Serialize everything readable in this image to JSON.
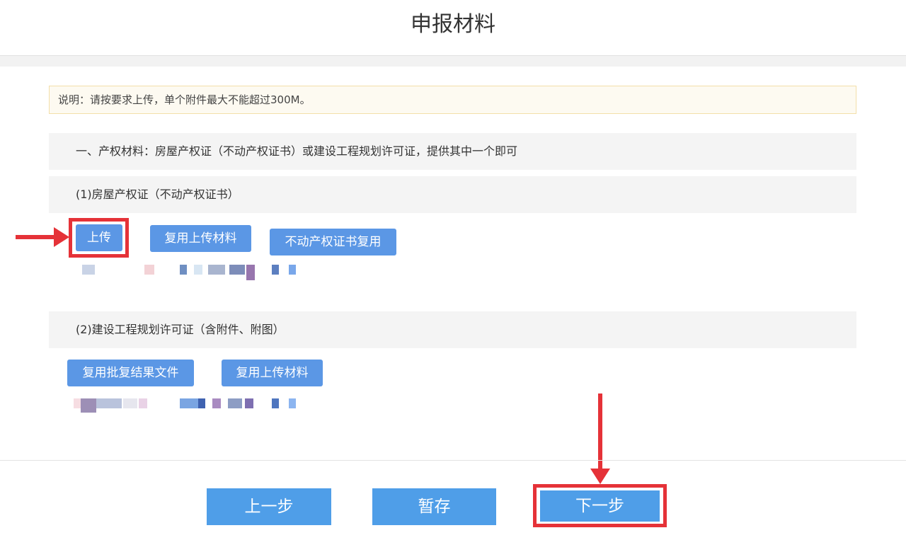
{
  "header": {
    "title": "申报材料"
  },
  "notice": {
    "text": "说明：请按要求上传，单个附件最大不能超过300M。"
  },
  "section_property": {
    "title": "一、产权材料：房屋产权证（不动产权证书）或建设工程规划许可证，提供其中一个即可",
    "sub1": {
      "title": "(1)房屋产权证（不动产权证书）",
      "upload_label": "上传",
      "reuse_label": "复用上传材料",
      "cert_reuse_label": "不动产权证书复用"
    },
    "sub2": {
      "title": "(2)建设工程规划许可证（含附件、附图）",
      "reuse_result_label": "复用批复结果文件",
      "reuse_label": "复用上传材料"
    }
  },
  "footer": {
    "prev_label": "上一步",
    "save_label": "暂存",
    "next_label": "下一步"
  },
  "colors": {
    "button_blue": "#5b97e5",
    "highlight_red": "#e53238"
  }
}
